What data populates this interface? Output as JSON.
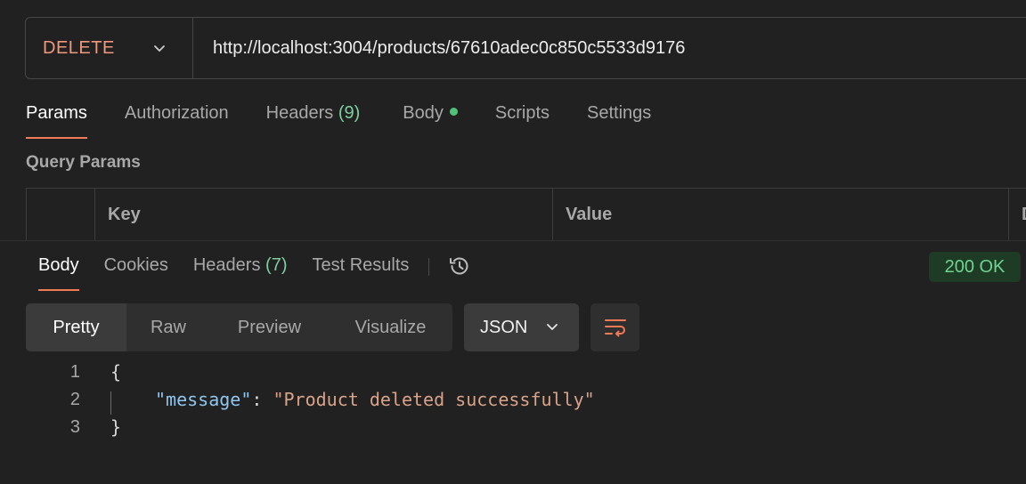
{
  "request": {
    "method": "DELETE",
    "url": "http://localhost:3004/products/67610adec0c850c5533d9176"
  },
  "request_tabs": [
    {
      "label": "Params",
      "count": ""
    },
    {
      "label": "Authorization",
      "count": ""
    },
    {
      "label": "Headers",
      "count": "(9)"
    },
    {
      "label": "Body",
      "count": ""
    },
    {
      "label": "Scripts",
      "count": ""
    },
    {
      "label": "Settings",
      "count": ""
    }
  ],
  "query_params": {
    "title": "Query Params",
    "columns": [
      "Key",
      "Value",
      "D"
    ]
  },
  "response_tabs": [
    {
      "label": "Body",
      "count": ""
    },
    {
      "label": "Cookies",
      "count": ""
    },
    {
      "label": "Headers",
      "count": "(7)"
    },
    {
      "label": "Test Results",
      "count": ""
    }
  ],
  "status": "200 OK",
  "view_modes": [
    "Pretty",
    "Raw",
    "Preview",
    "Visualize"
  ],
  "format": "JSON",
  "response_body": {
    "line_numbers": [
      "1",
      "2",
      "3"
    ],
    "open_brace": "{",
    "key": "\"message\"",
    "colon": ": ",
    "value": "\"Product deleted successfully\"",
    "close_brace": "}"
  },
  "colors": {
    "method": "#f0987a",
    "accent": "#ef7a55",
    "success": "#6ed48f",
    "dot": "#4fc27a"
  },
  "icons": [
    "chevron-down-icon",
    "history-icon",
    "wrap-lines-icon"
  ]
}
